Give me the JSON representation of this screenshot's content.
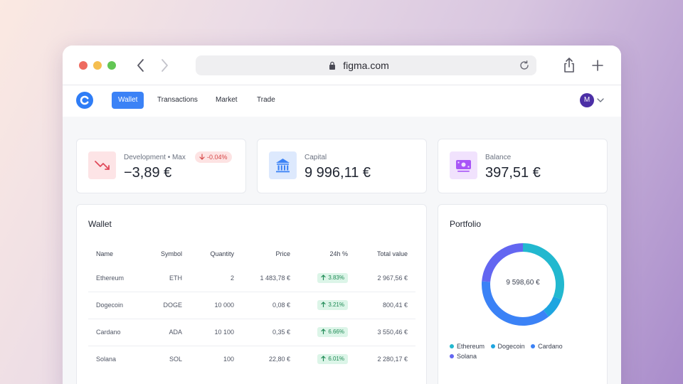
{
  "browser": {
    "url": "figma.com"
  },
  "nav": {
    "tabs": [
      {
        "label": "Wallet",
        "active": true
      },
      {
        "label": "Transactions",
        "active": false
      },
      {
        "label": "Market",
        "active": false
      },
      {
        "label": "Trade",
        "active": false
      }
    ],
    "avatar_initial": "M"
  },
  "stats": [
    {
      "label": "Development • Max",
      "value": "−3,89 €",
      "delta": "-0.04%",
      "icon": "trending-down-icon",
      "color": "#e0495a"
    },
    {
      "label": "Capital",
      "value": "9 996,11 €",
      "icon": "bank-icon",
      "color": "#3b82f6"
    },
    {
      "label": "Balance",
      "value": "397,51 €",
      "icon": "cash-icon",
      "color": "#a855f7"
    }
  ],
  "wallet": {
    "title": "Wallet",
    "columns": [
      "Name",
      "Symbol",
      "Quantity",
      "Price",
      "24h %",
      "Total value"
    ],
    "rows": [
      {
        "name": "Ethereum",
        "symbol": "ETH",
        "quantity": "2",
        "price": "1 483,78 €",
        "change": "3.83%",
        "total": "2 967,56 €"
      },
      {
        "name": "Dogecoin",
        "symbol": "DOGE",
        "quantity": "10 000",
        "price": "0,08 €",
        "change": "3.21%",
        "total": "800,41 €"
      },
      {
        "name": "Cardano",
        "symbol": "ADA",
        "quantity": "10 100",
        "price": "0,35 €",
        "change": "6.66%",
        "total": "3 550,46 €"
      },
      {
        "name": "Solana",
        "symbol": "SOL",
        "quantity": "100",
        "price": "22,80 €",
        "change": "6.01%",
        "total": "2 280,17 €"
      }
    ]
  },
  "portfolio": {
    "title": "Portfolio",
    "total": "9 598,60 €",
    "legend": [
      {
        "name": "Ethereum",
        "color": "#22b8cf"
      },
      {
        "name": "Dogecoin",
        "color": "#1ea5e0"
      },
      {
        "name": "Cardano",
        "color": "#3b82f6"
      },
      {
        "name": "Solana",
        "color": "#6366f1"
      }
    ]
  },
  "chart_data": {
    "type": "pie",
    "categories": [
      "Ethereum",
      "Dogecoin",
      "Cardano",
      "Solana"
    ],
    "values": [
      2967.56,
      800.41,
      3550.46,
      2280.17
    ],
    "colors": [
      "#22b8cf",
      "#1ea5e0",
      "#3b82f6",
      "#6366f1"
    ],
    "center_label": "9 598,60 €"
  }
}
